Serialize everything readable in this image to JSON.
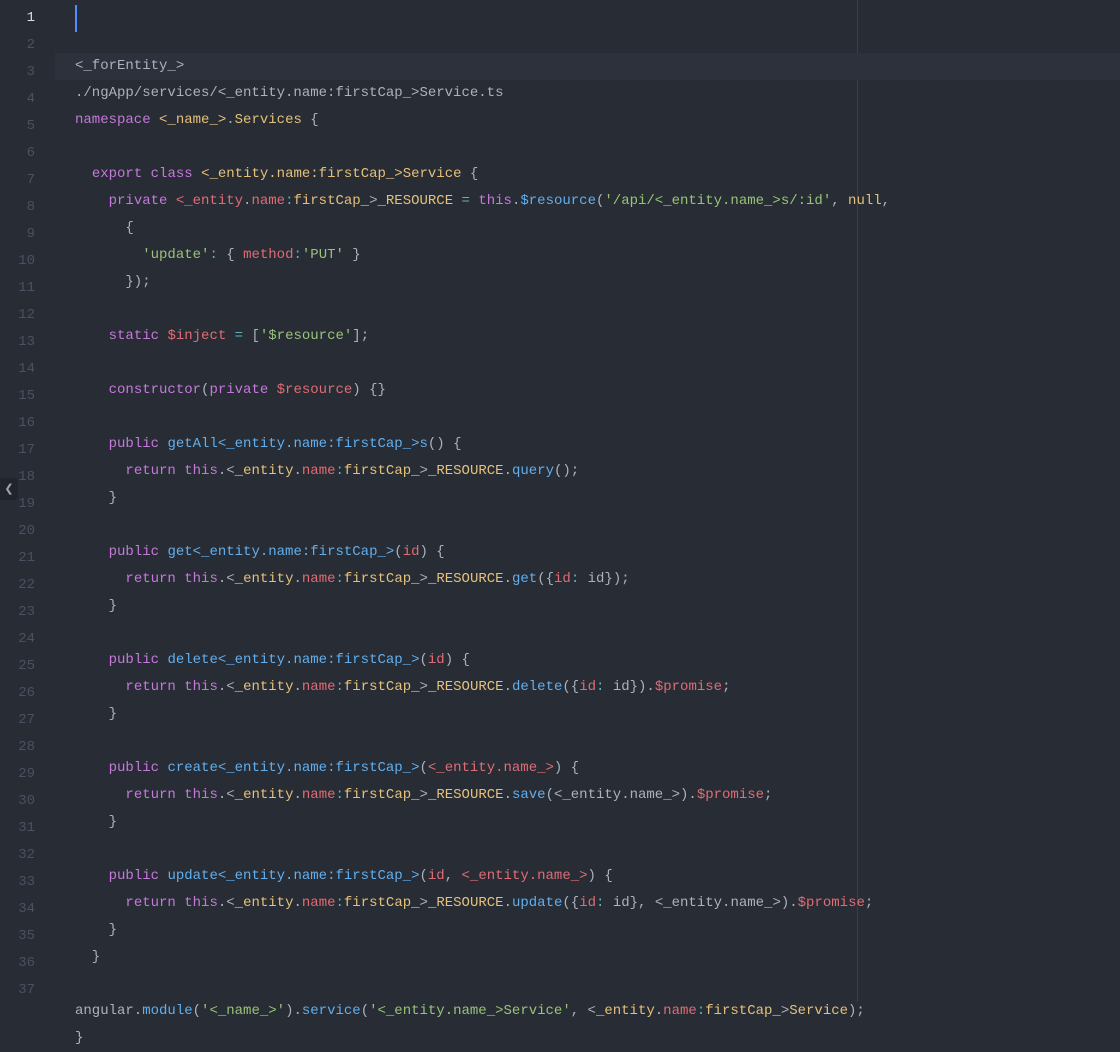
{
  "gutter": {
    "active_line": 1,
    "start": 1,
    "end": 37
  },
  "code_lines": [
    {
      "t": [
        [
          "pl",
          "<_forEntity_>"
        ]
      ]
    },
    {
      "t": [
        [
          "pl",
          "./ngApp/services/<_entity.name:firstCap_>Service.ts"
        ]
      ]
    },
    {
      "t": [
        [
          "kw",
          "namespace"
        ],
        [
          "pl",
          " "
        ],
        [
          "cls",
          "<_name_>"
        ],
        [
          "pl",
          "."
        ],
        [
          "cls",
          "Services"
        ],
        [
          "pl",
          " {"
        ]
      ]
    },
    {
      "t": [
        [
          "pl",
          ""
        ]
      ]
    },
    {
      "t": [
        [
          "pl",
          "  "
        ],
        [
          "kw",
          "export"
        ],
        [
          "pl",
          " "
        ],
        [
          "kw",
          "class"
        ],
        [
          "pl",
          " "
        ],
        [
          "cls",
          "<_entity.name:firstCap_>Service"
        ],
        [
          "pl",
          " {"
        ]
      ]
    },
    {
      "t": [
        [
          "pl",
          "    "
        ],
        [
          "kw",
          "private"
        ],
        [
          "pl",
          " "
        ],
        [
          "prop",
          "<_entity"
        ],
        [
          "pl",
          "."
        ],
        [
          "prop",
          "name"
        ],
        [
          "op",
          ":"
        ],
        [
          "cls",
          "firstCap_"
        ],
        [
          "pl",
          ">"
        ],
        [
          "cls",
          "_RESOURCE"
        ],
        [
          "pl",
          " "
        ],
        [
          "op",
          "="
        ],
        [
          "pl",
          " "
        ],
        [
          "kw",
          "this"
        ],
        [
          "pl",
          "."
        ],
        [
          "fn",
          "$resource"
        ],
        [
          "pl",
          "("
        ],
        [
          "str",
          "'/api/<_entity.name_>s/:id'"
        ],
        [
          "pl",
          ", "
        ],
        [
          "cls",
          "null"
        ],
        [
          "pl",
          ","
        ]
      ]
    },
    {
      "t": [
        [
          "pl",
          "      {"
        ]
      ]
    },
    {
      "t": [
        [
          "pl",
          "        "
        ],
        [
          "str",
          "'update'"
        ],
        [
          "op",
          ":"
        ],
        [
          "pl",
          " { "
        ],
        [
          "prop",
          "method"
        ],
        [
          "op",
          ":"
        ],
        [
          "str",
          "'PUT'"
        ],
        [
          "pl",
          " }"
        ]
      ]
    },
    {
      "t": [
        [
          "pl",
          "      });"
        ]
      ]
    },
    {
      "t": [
        [
          "pl",
          ""
        ]
      ]
    },
    {
      "t": [
        [
          "pl",
          "    "
        ],
        [
          "kw",
          "static"
        ],
        [
          "pl",
          " "
        ],
        [
          "prop",
          "$inject"
        ],
        [
          "pl",
          " "
        ],
        [
          "op",
          "="
        ],
        [
          "pl",
          " ["
        ],
        [
          "str",
          "'$resource'"
        ],
        [
          "pl",
          "];"
        ]
      ]
    },
    {
      "t": [
        [
          "pl",
          ""
        ]
      ]
    },
    {
      "t": [
        [
          "pl",
          "    "
        ],
        [
          "kw",
          "constructor"
        ],
        [
          "pl",
          "("
        ],
        [
          "kw",
          "private"
        ],
        [
          "pl",
          " "
        ],
        [
          "param",
          "$resource"
        ],
        [
          "pl",
          ") {}"
        ]
      ]
    },
    {
      "t": [
        [
          "pl",
          ""
        ]
      ]
    },
    {
      "t": [
        [
          "pl",
          "    "
        ],
        [
          "kw",
          "public"
        ],
        [
          "pl",
          " "
        ],
        [
          "fn",
          "getAll<_entity.name:firstCap_>s"
        ],
        [
          "pl",
          "() {"
        ]
      ]
    },
    {
      "t": [
        [
          "pl",
          "      "
        ],
        [
          "kw",
          "return"
        ],
        [
          "pl",
          " "
        ],
        [
          "kw",
          "this"
        ],
        [
          "pl",
          ".<"
        ],
        [
          "cls",
          "_entity"
        ],
        [
          "pl",
          "."
        ],
        [
          "prop",
          "name"
        ],
        [
          "op",
          ":"
        ],
        [
          "cls",
          "firstCap_"
        ],
        [
          "pl",
          ">"
        ],
        [
          "cls",
          "_RESOURCE"
        ],
        [
          "pl",
          "."
        ],
        [
          "fn",
          "query"
        ],
        [
          "pl",
          "();"
        ]
      ]
    },
    {
      "t": [
        [
          "pl",
          "    }"
        ]
      ]
    },
    {
      "t": [
        [
          "pl",
          ""
        ]
      ]
    },
    {
      "t": [
        [
          "pl",
          "    "
        ],
        [
          "kw",
          "public"
        ],
        [
          "pl",
          " "
        ],
        [
          "fn",
          "get<_entity.name:firstCap_>"
        ],
        [
          "pl",
          "("
        ],
        [
          "param",
          "id"
        ],
        [
          "pl",
          ") {"
        ]
      ]
    },
    {
      "t": [
        [
          "pl",
          "      "
        ],
        [
          "kw",
          "return"
        ],
        [
          "pl",
          " "
        ],
        [
          "kw",
          "this"
        ],
        [
          "pl",
          ".<"
        ],
        [
          "cls",
          "_entity"
        ],
        [
          "pl",
          "."
        ],
        [
          "prop",
          "name"
        ],
        [
          "op",
          ":"
        ],
        [
          "cls",
          "firstCap_"
        ],
        [
          "pl",
          ">"
        ],
        [
          "cls",
          "_RESOURCE"
        ],
        [
          "pl",
          "."
        ],
        [
          "fn",
          "get"
        ],
        [
          "pl",
          "({"
        ],
        [
          "prop",
          "id"
        ],
        [
          "op",
          ":"
        ],
        [
          "pl",
          " id});"
        ]
      ]
    },
    {
      "t": [
        [
          "pl",
          "    }"
        ]
      ]
    },
    {
      "t": [
        [
          "pl",
          ""
        ]
      ]
    },
    {
      "t": [
        [
          "pl",
          "    "
        ],
        [
          "kw",
          "public"
        ],
        [
          "pl",
          " "
        ],
        [
          "fn",
          "delete<_entity.name:firstCap_>"
        ],
        [
          "pl",
          "("
        ],
        [
          "param",
          "id"
        ],
        [
          "pl",
          ") {"
        ]
      ]
    },
    {
      "t": [
        [
          "pl",
          "      "
        ],
        [
          "kw",
          "return"
        ],
        [
          "pl",
          " "
        ],
        [
          "kw",
          "this"
        ],
        [
          "pl",
          ".<"
        ],
        [
          "cls",
          "_entity"
        ],
        [
          "pl",
          "."
        ],
        [
          "prop",
          "name"
        ],
        [
          "op",
          ":"
        ],
        [
          "cls",
          "firstCap_"
        ],
        [
          "pl",
          ">"
        ],
        [
          "cls",
          "_RESOURCE"
        ],
        [
          "pl",
          "."
        ],
        [
          "fn",
          "delete"
        ],
        [
          "pl",
          "({"
        ],
        [
          "prop",
          "id"
        ],
        [
          "op",
          ":"
        ],
        [
          "pl",
          " id})."
        ],
        [
          "prop",
          "$promise"
        ],
        [
          "pl",
          ";"
        ]
      ]
    },
    {
      "t": [
        [
          "pl",
          "    }"
        ]
      ]
    },
    {
      "t": [
        [
          "pl",
          ""
        ]
      ]
    },
    {
      "t": [
        [
          "pl",
          "    "
        ],
        [
          "kw",
          "public"
        ],
        [
          "pl",
          " "
        ],
        [
          "fn",
          "create<_entity.name:firstCap_>"
        ],
        [
          "pl",
          "("
        ],
        [
          "param",
          "<_entity.name_>"
        ],
        [
          "pl",
          ") {"
        ]
      ]
    },
    {
      "t": [
        [
          "pl",
          "      "
        ],
        [
          "kw",
          "return"
        ],
        [
          "pl",
          " "
        ],
        [
          "kw",
          "this"
        ],
        [
          "pl",
          ".<"
        ],
        [
          "cls",
          "_entity"
        ],
        [
          "pl",
          "."
        ],
        [
          "prop",
          "name"
        ],
        [
          "op",
          ":"
        ],
        [
          "cls",
          "firstCap_"
        ],
        [
          "pl",
          ">"
        ],
        [
          "cls",
          "_RESOURCE"
        ],
        [
          "pl",
          "."
        ],
        [
          "fn",
          "save"
        ],
        [
          "pl",
          "(<_entity.name_>)."
        ],
        [
          "prop",
          "$promise"
        ],
        [
          "pl",
          ";"
        ]
      ]
    },
    {
      "t": [
        [
          "pl",
          "    }"
        ]
      ]
    },
    {
      "t": [
        [
          "pl",
          ""
        ]
      ]
    },
    {
      "t": [
        [
          "pl",
          "    "
        ],
        [
          "kw",
          "public"
        ],
        [
          "pl",
          " "
        ],
        [
          "fn",
          "update<_entity.name:firstCap_>"
        ],
        [
          "pl",
          "("
        ],
        [
          "param",
          "id"
        ],
        [
          "pl",
          ", "
        ],
        [
          "param",
          "<_entity.name_>"
        ],
        [
          "pl",
          ") {"
        ]
      ]
    },
    {
      "t": [
        [
          "pl",
          "      "
        ],
        [
          "kw",
          "return"
        ],
        [
          "pl",
          " "
        ],
        [
          "kw",
          "this"
        ],
        [
          "pl",
          ".<"
        ],
        [
          "cls",
          "_entity"
        ],
        [
          "pl",
          "."
        ],
        [
          "prop",
          "name"
        ],
        [
          "op",
          ":"
        ],
        [
          "cls",
          "firstCap_"
        ],
        [
          "pl",
          ">"
        ],
        [
          "cls",
          "_RESOURCE"
        ],
        [
          "pl",
          "."
        ],
        [
          "fn",
          "update"
        ],
        [
          "pl",
          "({"
        ],
        [
          "prop",
          "id"
        ],
        [
          "op",
          ":"
        ],
        [
          "pl",
          " id}, <_entity.name_>)."
        ],
        [
          "prop",
          "$promise"
        ],
        [
          "pl",
          ";"
        ]
      ]
    },
    {
      "t": [
        [
          "pl",
          "    }"
        ]
      ]
    },
    {
      "t": [
        [
          "pl",
          "  }"
        ]
      ]
    },
    {
      "t": [
        [
          "pl",
          ""
        ]
      ]
    },
    {
      "t": [
        [
          "pl",
          "angular."
        ],
        [
          "fn",
          "module"
        ],
        [
          "pl",
          "("
        ],
        [
          "str",
          "'<_name_>'"
        ],
        [
          "pl",
          ")."
        ],
        [
          "fn",
          "service"
        ],
        [
          "pl",
          "("
        ],
        [
          "str",
          "'<_entity.name_>Service'"
        ],
        [
          "pl",
          ", <"
        ],
        [
          "cls",
          "_entity"
        ],
        [
          "pl",
          "."
        ],
        [
          "prop",
          "name"
        ],
        [
          "op",
          ":"
        ],
        [
          "cls",
          "firstCap_"
        ],
        [
          "pl",
          ">"
        ],
        [
          "cls",
          "Service"
        ],
        [
          "pl",
          ");"
        ]
      ]
    },
    {
      "t": [
        [
          "pl",
          "}"
        ]
      ]
    }
  ],
  "fold_handle_glyph": "❮"
}
